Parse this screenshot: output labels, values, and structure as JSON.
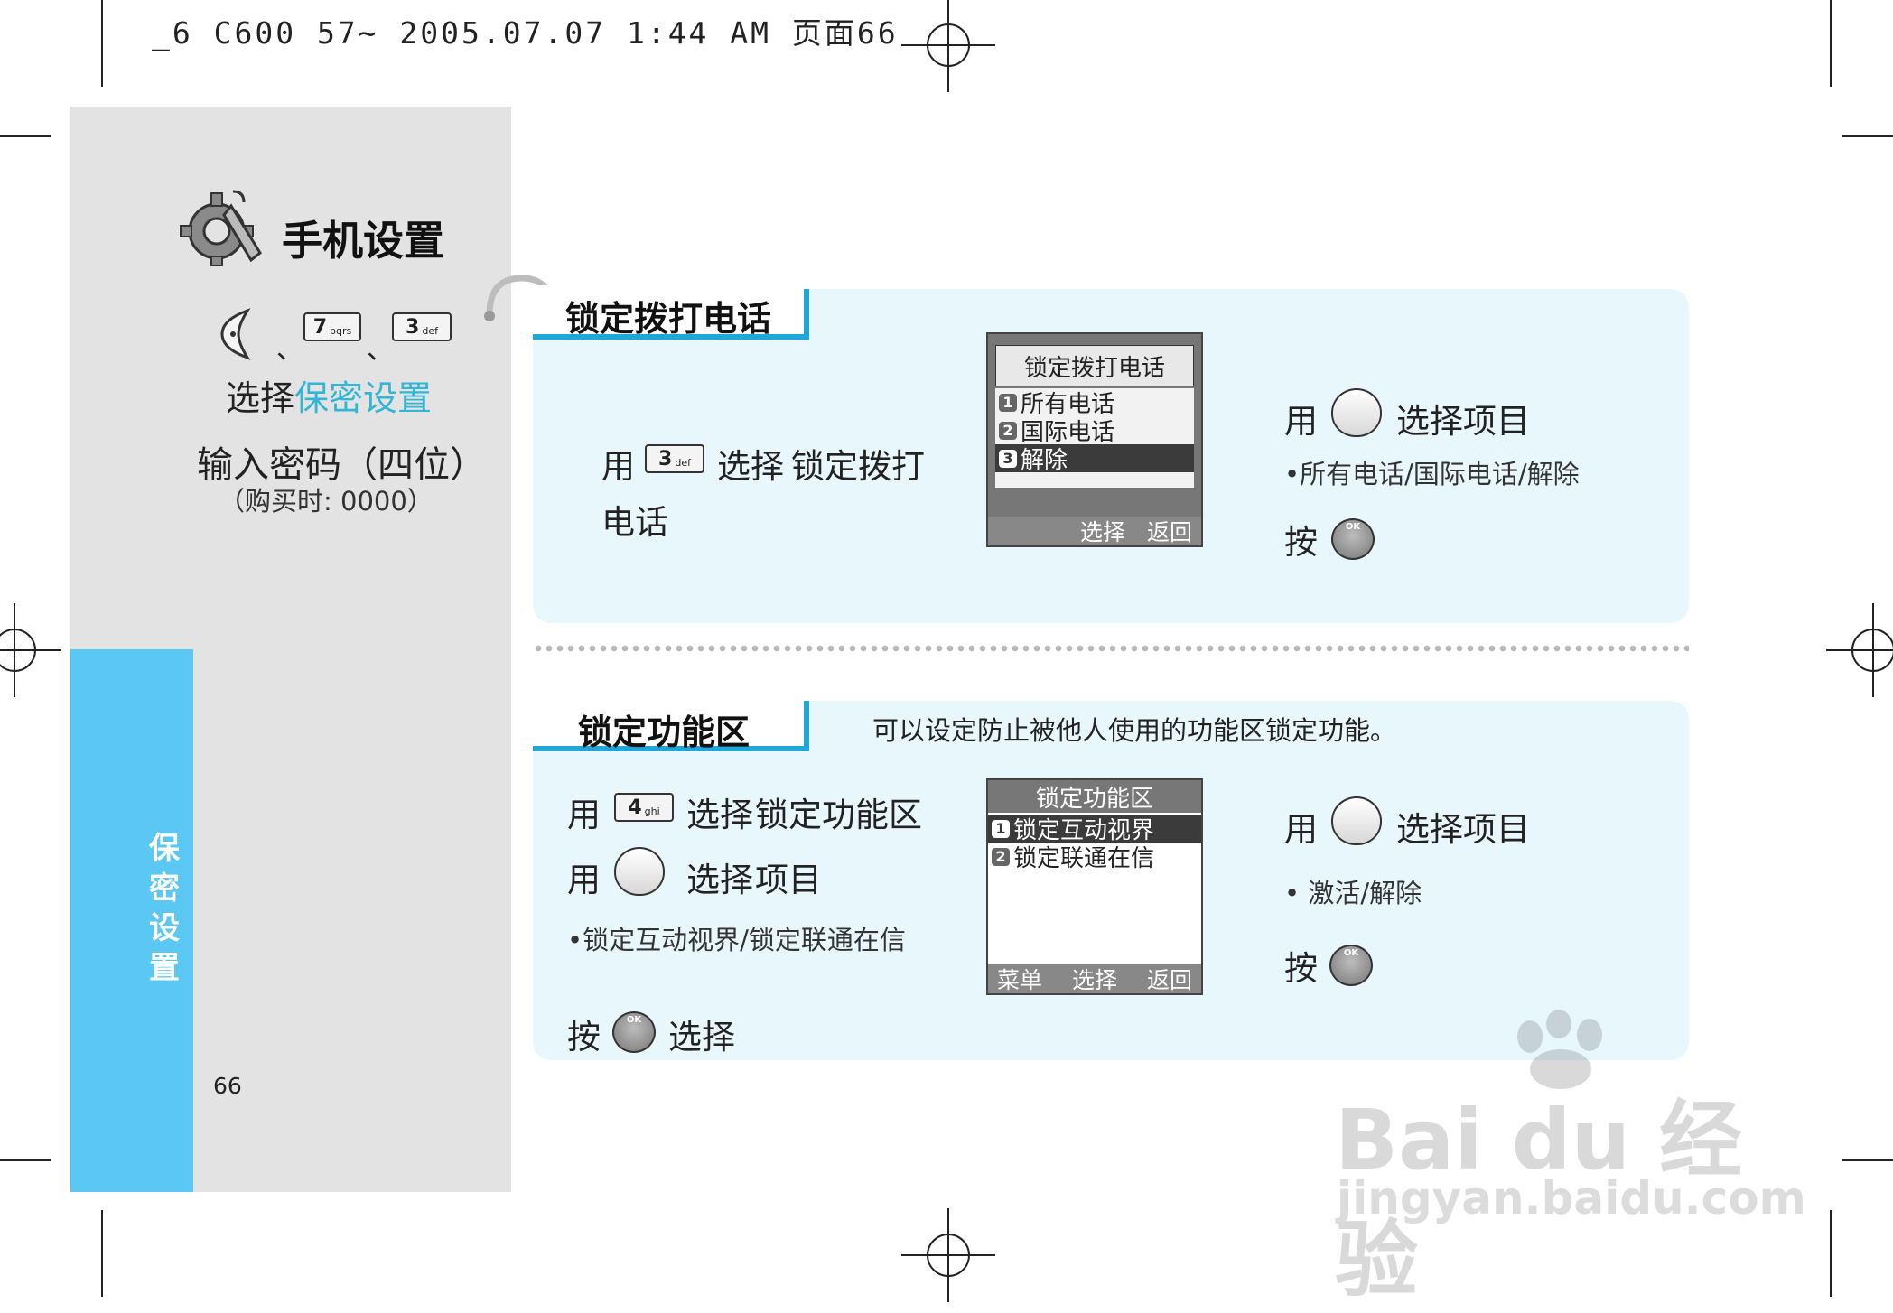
{
  "header": {
    "print_line": "_6 C600 57~ 2005.07.07 1:44 AM 页面66"
  },
  "sidebar": {
    "title": "手机设置",
    "separator": "、",
    "key_7": "7",
    "key_7_sub": "pqrs",
    "key_3": "3",
    "key_3_sub": "def",
    "select_prefix": "选择",
    "select_target": "保密设置",
    "password_line": "输入密码（四位）",
    "purchase_line": "（购买时: 0000）",
    "vertical_label": [
      "保",
      "密",
      "设",
      "置"
    ],
    "page_number": "66"
  },
  "section1": {
    "title": "锁定拨打电话",
    "use": "用",
    "key": "3",
    "key_sub": "def",
    "select_word": "选择",
    "target_line1": "锁定拨打",
    "target_line2": "电话",
    "screen": {
      "header": "锁定拨打电话",
      "items": [
        {
          "num": "1",
          "label": "所有电话"
        },
        {
          "num": "2",
          "label": "国际电话"
        },
        {
          "num": "3",
          "label": "解除"
        }
      ],
      "soft_left": "选择",
      "soft_right": "返回"
    },
    "right_use": "用",
    "right_select": "选择项目",
    "right_options": "•所有电话/国际电话/解除",
    "right_press": "按",
    "ok_label": "OK"
  },
  "section2": {
    "title": "锁定功能区",
    "description": "可以设定防止被他人使用的功能区锁定功能。",
    "line1_use": "用",
    "line1_key": "4",
    "line1_key_sub": "ghi",
    "line1_select": "选择",
    "line1_target": "锁定功能区",
    "line2_use": "用",
    "line2_select": "选择",
    "line2_target": "项目",
    "bullet": "•锁定互动视界/锁定联通在信",
    "press": "按",
    "press_select": "选择",
    "screen": {
      "header": "锁定功能区",
      "items": [
        {
          "num": "1",
          "label": "锁定互动视界"
        },
        {
          "num": "2",
          "label": "锁定联通在信"
        }
      ],
      "soft_left": "菜单",
      "soft_mid": "选择",
      "soft_right": "返回"
    },
    "right_use": "用",
    "right_select": "选择项目",
    "right_options": "• 激活/解除",
    "right_press": "按",
    "ok_label": "OK"
  },
  "watermark": {
    "brand": "Bai du 经验",
    "url": "jingyan.baidu.com"
  },
  "colors": {
    "accent_cyan": "#32b6d6",
    "sidebar_blue": "#5ac8f2",
    "panel_bg": "#e8f7fc",
    "sidebar_gray": "#e3e3e3"
  }
}
